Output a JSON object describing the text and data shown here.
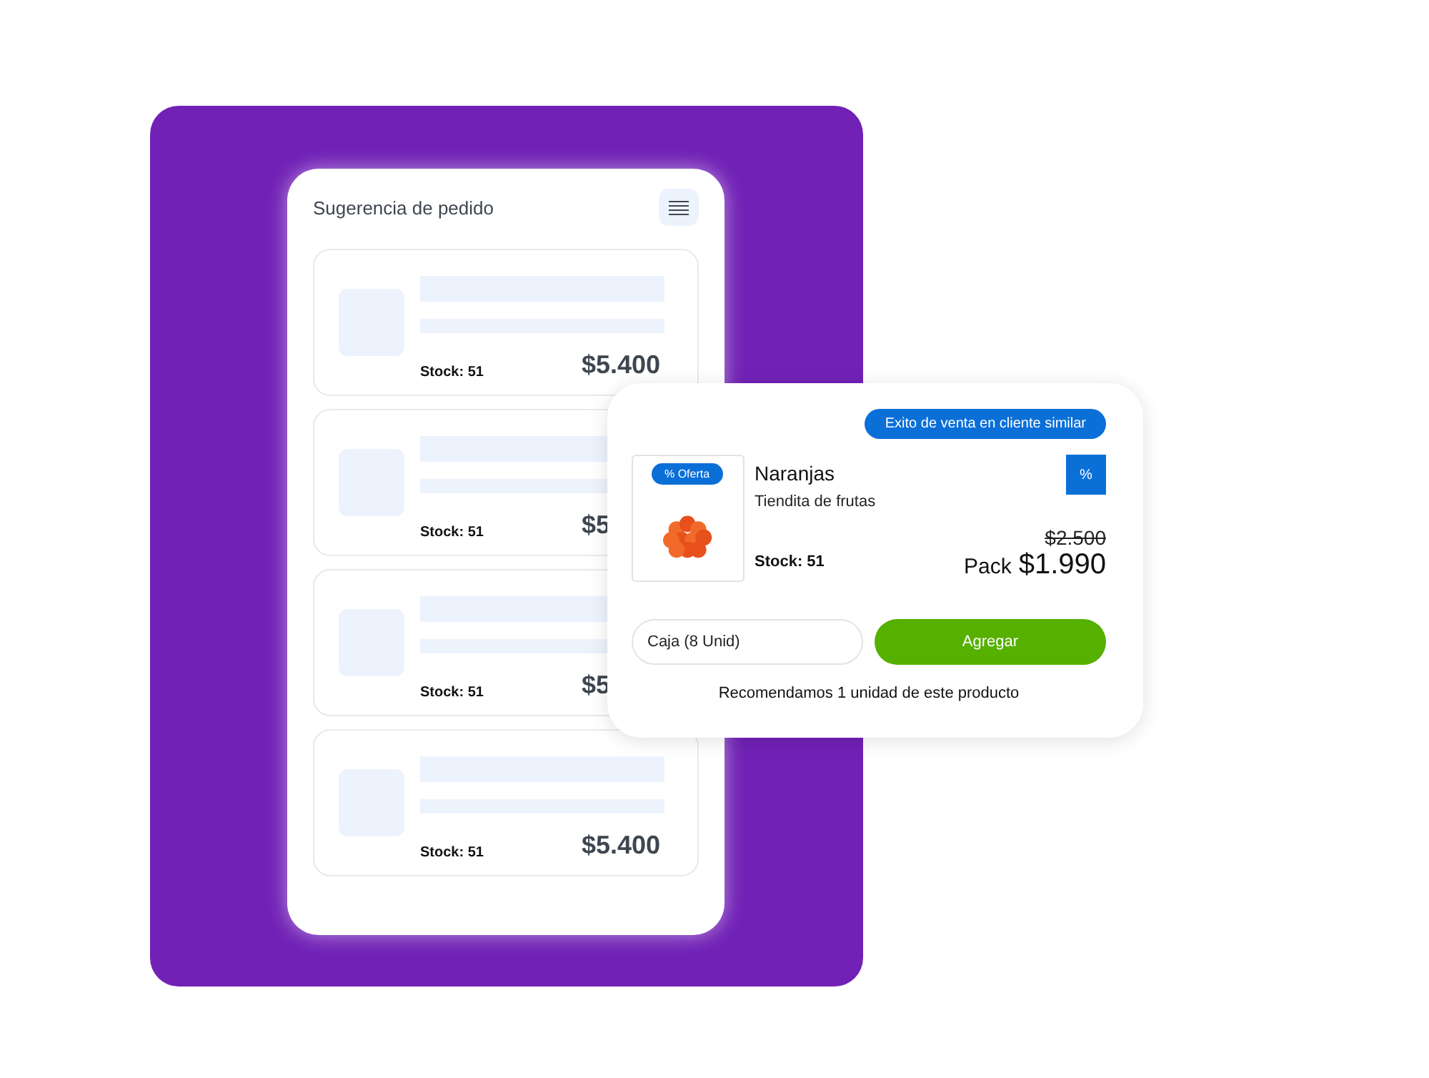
{
  "panel": {
    "title": "Sugerencia de pedido",
    "items": [
      {
        "stock": "Stock: 51",
        "price": "$5.400"
      },
      {
        "stock": "Stock: 51",
        "price": "$5"
      },
      {
        "stock": "Stock: 51",
        "price": "$5"
      },
      {
        "stock": "Stock: 51",
        "price": "$5.400"
      }
    ]
  },
  "product_card": {
    "badge": "Exito de venta en cliente similar",
    "offer_tag": "% Oferta",
    "name": "Naranjas",
    "store": "Tiendita de frutas",
    "discount_icon": "%",
    "stock": "Stock: 51",
    "old_price": "$2.500",
    "price_prefix": "Pack",
    "price": "$1.990",
    "unit_select": "Caja (8 Unid)",
    "add_button": "Agregar",
    "note": "Recomendamos 1 unidad de este producto"
  }
}
